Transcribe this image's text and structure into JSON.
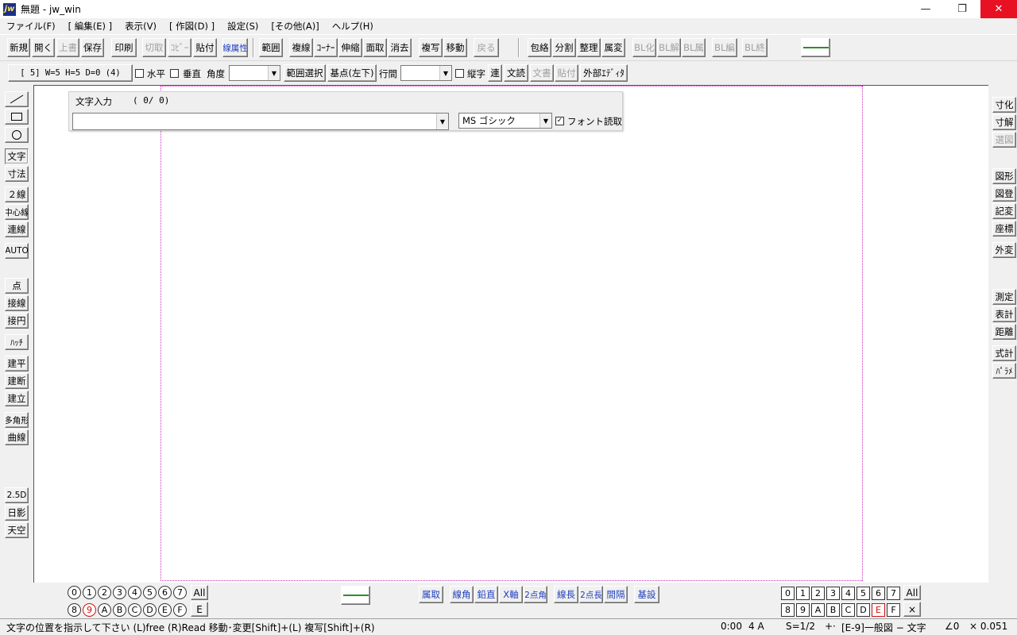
{
  "window": {
    "title": "無題 - jw_win",
    "app_icon": "jw"
  },
  "menu": [
    "ファイル(F)",
    "[ 編集(E) ]",
    "表示(V)",
    "[ 作図(D) ]",
    "設定(S)",
    "[その他(A)]",
    "ヘルプ(H)"
  ],
  "toolbar1": {
    "file": [
      "新規",
      "開く",
      "上書",
      "保存"
    ],
    "print": "印刷",
    "clip": [
      "切取",
      "ｺﾋﾟｰ",
      "貼付"
    ],
    "attr": "線属性",
    "edit": [
      "範囲",
      "複線",
      "ｺｰﾅｰ",
      "伸縮",
      "面取",
      "消去",
      "複写",
      "移動",
      "戻る"
    ],
    "block": [
      "包絡",
      "分割",
      "整理",
      "属変",
      "BL化",
      "BL解",
      "BL属",
      "BL編",
      "BL終"
    ]
  },
  "toolbar2": {
    "text_type": "[ 5]  W=5  H=5  D=0 (4)",
    "horizontal": "水平",
    "vertical": "垂直",
    "angle": "角度",
    "range_select": "範囲選択",
    "base_point": "基点(左下)",
    "line_spacing": "行間",
    "tategaki": "縦字",
    "ren": "連",
    "read": "文読",
    "doc": "文書",
    "paste": "貼付",
    "ext_editor": "外部ｴﾃﾞｨﾀ"
  },
  "text_input": {
    "title": "文字入力",
    "count": "( 0/  0)",
    "value": "",
    "font": "MS ゴシック",
    "font_read": "フォント読取",
    "font_read_checked": true
  },
  "left_tools": [
    "／",
    "□",
    "○",
    "文字",
    "寸法",
    "２線",
    "中心線",
    "連線",
    "AUTO",
    "点",
    "接線",
    "接円",
    "ﾊｯﾁ",
    "建平",
    "建断",
    "建立",
    "多角形",
    "曲線",
    "2.5D",
    "日影",
    "天空"
  ],
  "right_tools": [
    "寸化",
    "寸解",
    "選図",
    "図形",
    "図登",
    "記変",
    "座標",
    "外変",
    "測定",
    "表計",
    "距離",
    "式計",
    "ﾊﾟﾗﾒ"
  ],
  "layer_group": {
    "top": [
      "0",
      "1",
      "2",
      "3",
      "4",
      "5",
      "6",
      "7"
    ],
    "bottom": [
      "8",
      "9",
      "A",
      "B",
      "C",
      "D",
      "E",
      "F"
    ],
    "all": "All",
    "current": "E"
  },
  "bottom_tools": [
    "属取",
    "線角",
    "鉛直",
    "X軸",
    "2点角",
    "線長",
    "2点長",
    "間隔",
    "基設"
  ],
  "layers": {
    "top": [
      "0",
      "1",
      "2",
      "3",
      "4",
      "5",
      "6",
      "7"
    ],
    "bottom": [
      "8",
      "9",
      "A",
      "B",
      "C",
      "D",
      "E",
      "F"
    ],
    "all": "All",
    "cross": "×"
  },
  "status": {
    "message": "文字の位置を指示して下さい (L)free (R)Read  移動･変更[Shift]+(L) 複写[Shift]+(R)",
    "coord": "0:00",
    "paper": "4 A",
    "scale": "S=1/2",
    "arrow": "+·",
    "layer": "[E-9]一般図 − 文字",
    "angle": "∠0",
    "zoom": "× 0.051"
  },
  "colors": {
    "accent_blue": "#1f3fbf",
    "paper_frame": "#d02cc0",
    "close_red": "#e81123",
    "line_green": "#2a8f2a"
  }
}
